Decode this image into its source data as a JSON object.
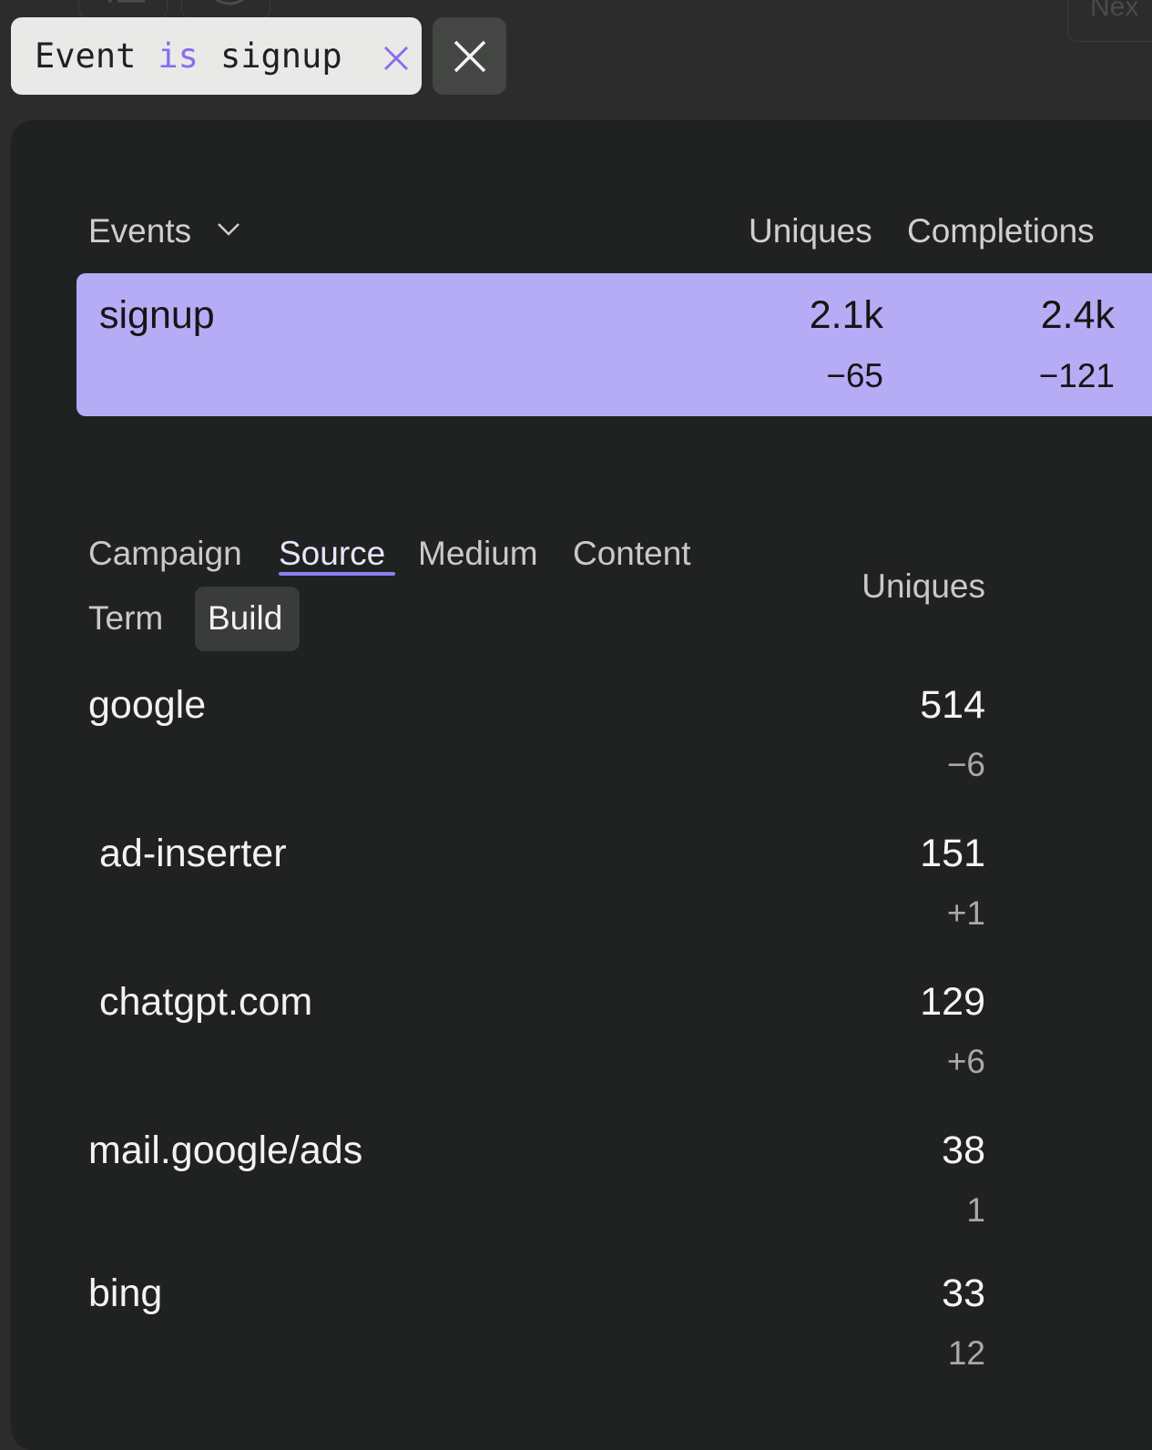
{
  "toolbar": {
    "next_label": "Nex",
    "filter": {
      "field": "Event",
      "operator": "is",
      "value": "signup"
    }
  },
  "events_table": {
    "header": {
      "label": "Events",
      "uniques": "Uniques",
      "completions": "Completions"
    },
    "rows": [
      {
        "name": "signup",
        "uniques": "2.1k",
        "uniques_delta": "−65",
        "completions": "2.4k",
        "completions_delta": "−121"
      }
    ]
  },
  "breakdown": {
    "tabs": [
      "Campaign",
      "Source",
      "Medium",
      "Content",
      "Term",
      "Build"
    ],
    "active_tab": "Source",
    "hover_tab": "Build",
    "column_header": "Uniques",
    "rows": [
      {
        "name": "google",
        "value": "514",
        "delta": "−6"
      },
      {
        "name": "ad-inserter",
        "value": "151",
        "delta": "+1"
      },
      {
        "name": "chatgpt.com",
        "value": "129",
        "delta": "+6"
      },
      {
        "name": "mail.google/ads",
        "value": "38",
        "delta": "1"
      },
      {
        "name": "bing",
        "value": "33",
        "delta": "12"
      }
    ]
  },
  "colors": {
    "accent": "#8e7ef5",
    "highlight_row": "#b6acf6",
    "panel": "#202221",
    "background": "#2b2c2b"
  }
}
